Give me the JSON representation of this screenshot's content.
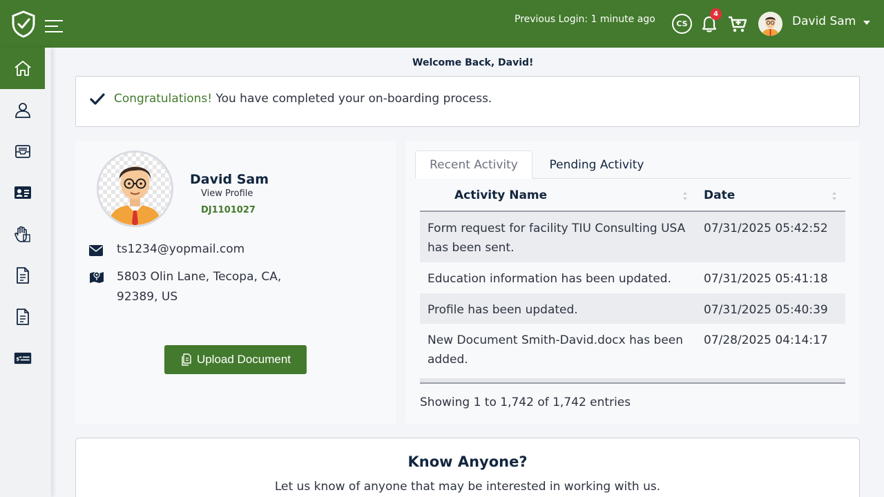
{
  "header": {
    "previous_login": "Previous Login: 1 minute ago",
    "cs_label": "CS",
    "notification_count": "4",
    "user_name": "David Sam"
  },
  "welcome": "Welcome Back, David!",
  "alert": {
    "highlight": "Congratulations!",
    "message": " You have completed your on-boarding process."
  },
  "profile": {
    "name": "David Sam",
    "view_profile": "View Profile",
    "id": "DJ1101027",
    "email": "ts1234@yopmail.com",
    "address": "5803 Olin Lane, Tecopa, CA, 92389, US",
    "upload_label": "Upload Document"
  },
  "activity": {
    "tabs": [
      "Recent Activity",
      "Pending Activity"
    ],
    "columns": [
      "Activity Name",
      "Date"
    ],
    "rows": [
      {
        "name": "Form request for facility TIU Consulting USA has been sent.",
        "date": "07/31/2025 05:42:52"
      },
      {
        "name": "Education information has been updated.",
        "date": "07/31/2025 05:41:18"
      },
      {
        "name": "Profile has been updated.",
        "date": "07/31/2025 05:40:39"
      },
      {
        "name": "New Document Smith-David.docx has been added.",
        "date": "07/28/2025 04:14:17"
      }
    ],
    "entries": "Showing 1 to 1,742 of 1,742 entries"
  },
  "know_anyone": {
    "title": "Know Anyone?",
    "subtitle": "Let us know of anyone that may be interested in working with us."
  },
  "colors": {
    "brand_green": "#437a2d",
    "badge_red": "#e0313a",
    "navy": "#12263f"
  },
  "icons": {
    "sidebar": [
      "home-icon",
      "user-icon",
      "inbox-icon",
      "id-card-icon",
      "hand-icon",
      "document-icon",
      "document-icon",
      "payment-card-icon"
    ]
  }
}
